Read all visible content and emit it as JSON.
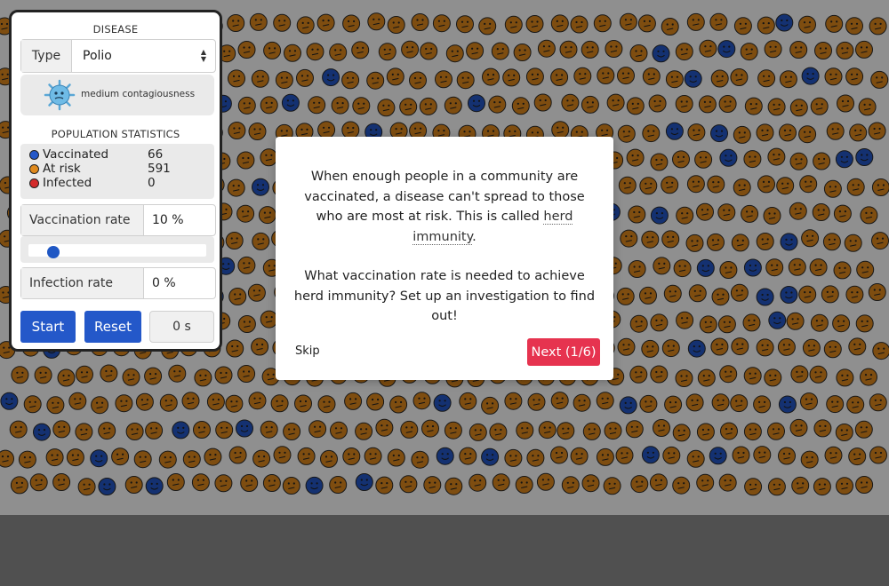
{
  "panel": {
    "disease_title": "DISEASE",
    "type_label": "Type",
    "type_value": "Polio",
    "contagiousness": "medium contagiousness",
    "stats_title": "POPULATION STATISTICS",
    "stats": [
      {
        "label": "Vaccinated",
        "value": "66",
        "color": "#2458c9"
      },
      {
        "label": "At risk",
        "value": "591",
        "color": "#e08a1e"
      },
      {
        "label": "Infected",
        "value": "0",
        "color": "#d42b2b"
      }
    ],
    "vaccination_rate_label": "Vaccination rate",
    "vaccination_rate_value": "10 %",
    "vaccination_rate_fraction": 0.1,
    "infection_rate_label": "Infection rate",
    "infection_rate_value": "0 %",
    "start_label": "Start",
    "reset_label": "Reset",
    "timer": "0 s"
  },
  "modal": {
    "para1_prefix": "When enough people in a community are vaccinated, a disease can't spread to those who are most at risk. This is called ",
    "para1_term": "herd immunity",
    "para1_suffix": ".",
    "para2": "What vaccination rate is needed to achieve herd immunity? Set up an investigation to find out!",
    "skip_label": "Skip",
    "next_label": "Next (1/6)"
  },
  "colors": {
    "vaccinated": "#2458c9",
    "at_risk": "#e08a1e",
    "next_button": "#e6334f",
    "primary_button": "#2458c9"
  },
  "icons": {
    "virus": "virus-icon",
    "person_at_risk": "worried-face-icon",
    "person_vaccinated": "smiling-face-icon"
  }
}
